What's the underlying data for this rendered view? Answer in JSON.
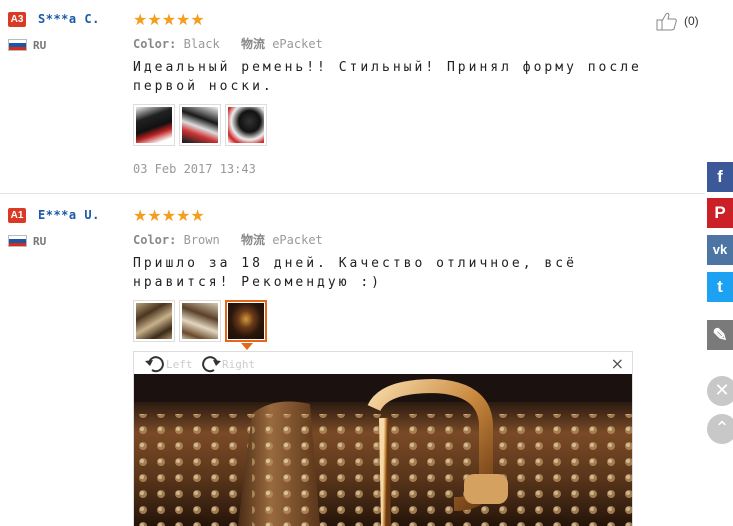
{
  "reviews": [
    {
      "badge": "A3",
      "name": "S***a C.",
      "country": "RU",
      "stars": "★★★★★",
      "color_label": "Color:",
      "color_value": "Black",
      "shipping_label": "物流",
      "shipping_value": "ePacket",
      "text": "Идеальный ремень!! Стильный! Принял форму после первой носки.",
      "date": "03 Feb 2017 13:43",
      "likes": "(0)",
      "thumbs": [
        "black-belt-photo-1",
        "black-belt-photo-2",
        "black-belt-photo-3"
      ]
    },
    {
      "badge": "A1",
      "name": "E***a U.",
      "country": "RU",
      "stars": "★★★★★",
      "color_label": "Color:",
      "color_value": "Brown",
      "shipping_label": "物流",
      "shipping_value": "ePacket",
      "text": "Пришло за 18 дней. Качество отличное, всё нравится! Рекомендую :)",
      "likes": "(0)",
      "thumbs": [
        "brown-belt-photo-1",
        "brown-belt-photo-2",
        "brown-belt-photo-3"
      ]
    }
  ],
  "viewer": {
    "rotate_left": "Left",
    "rotate_right": "Right",
    "close": "×"
  },
  "social": {
    "facebook": "f",
    "pinterest": "P",
    "vk": "vk",
    "twitter": "t",
    "edit": "✎",
    "close": "✕",
    "up": "⌃"
  },
  "colors": {
    "facebook": "#3b5998",
    "pinterest": "#cb2027",
    "vk": "#4c75a3",
    "twitter": "#1da1f2",
    "edit": "#7a7a7a",
    "star": "#f59d1c",
    "badge": "#d93a25",
    "username": "#1a5aa8"
  }
}
